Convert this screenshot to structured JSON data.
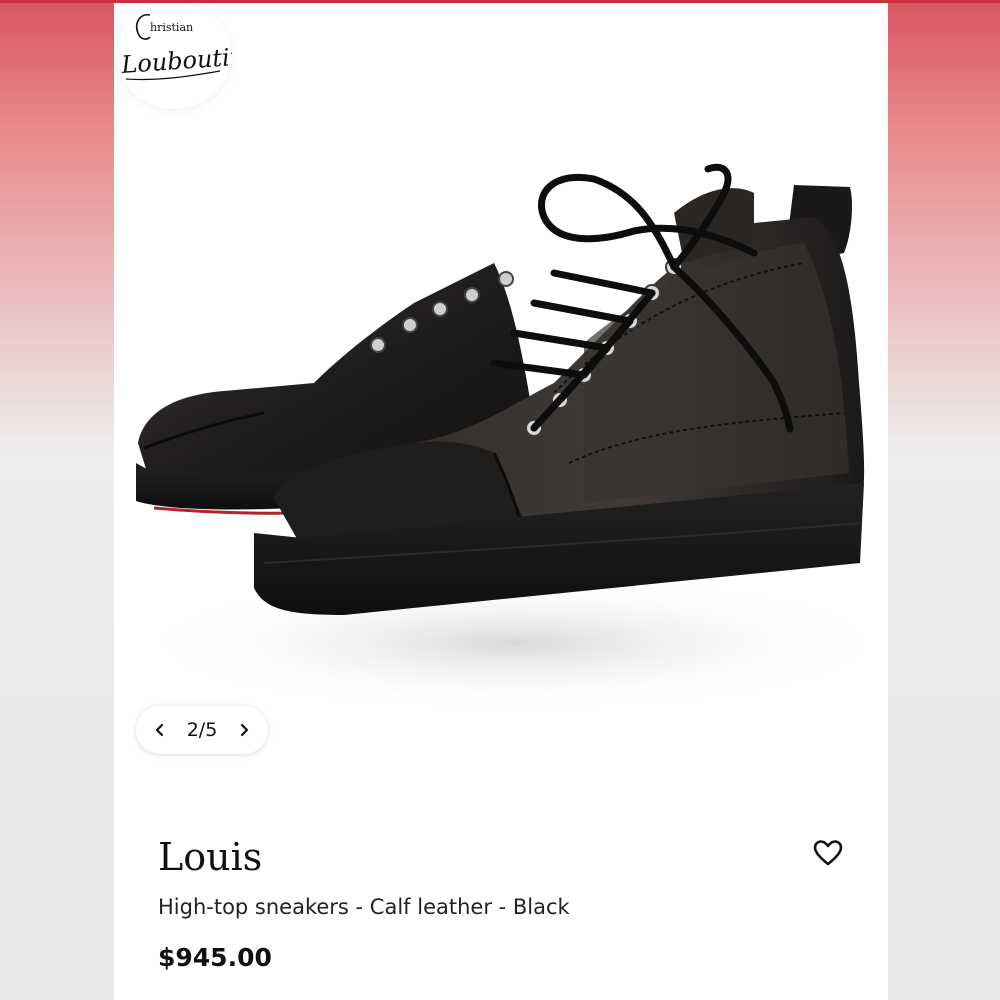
{
  "brand": {
    "logo_line1": "hristian",
    "logo_line2": "Louboutin"
  },
  "gallery": {
    "current_page": 2,
    "total_pages": 5,
    "counter_text": "2/5",
    "prev_icon": "chevron-left-icon",
    "next_icon": "chevron-right-icon"
  },
  "product": {
    "name": "Louis",
    "description": "High-top sneakers - Calf leather - Black",
    "price": "$945.00",
    "wishlist_icon": "heart-outline-icon"
  },
  "colors": {
    "border_top": "#c9303c",
    "side_gradient_top": "#d9565f",
    "shoe_leather": "#1e1c1b",
    "sole_red": "#b5232a"
  }
}
